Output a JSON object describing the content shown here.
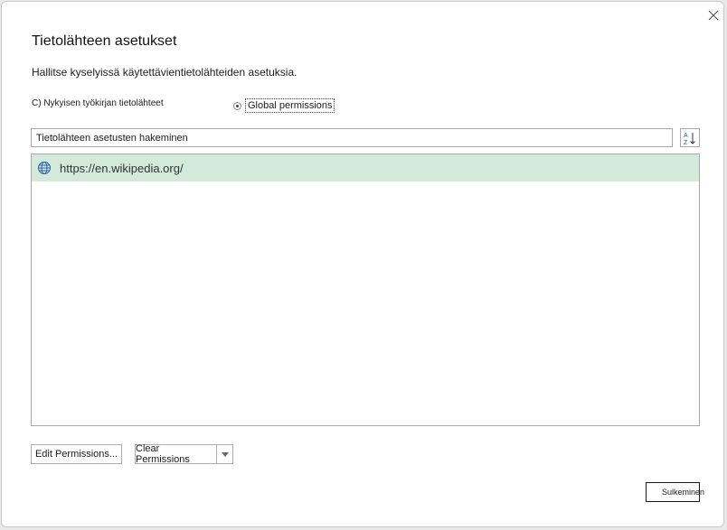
{
  "dialog": {
    "title": "Tietolähteen asetukset",
    "description": "Hallitse kyselyissä käytettävientietolähteiden asetuksia.",
    "options": {
      "current_workbook": "C) Nykyisen työkirjan tietolähteet",
      "global": "Global permissions",
      "selected": "global"
    },
    "search": {
      "value": "Tietolähteen asetusten hakeminen"
    },
    "sources": [
      {
        "url": "https://en.wikipedia.org/",
        "icon": "globe-icon",
        "selected": true
      }
    ],
    "buttons": {
      "edit": "Edit Permissions...",
      "clear": "Clear Permissions",
      "close": "Sulkeminen"
    },
    "colors": {
      "selected_row": "#d3eadb",
      "border": "#a9a9a9"
    }
  }
}
